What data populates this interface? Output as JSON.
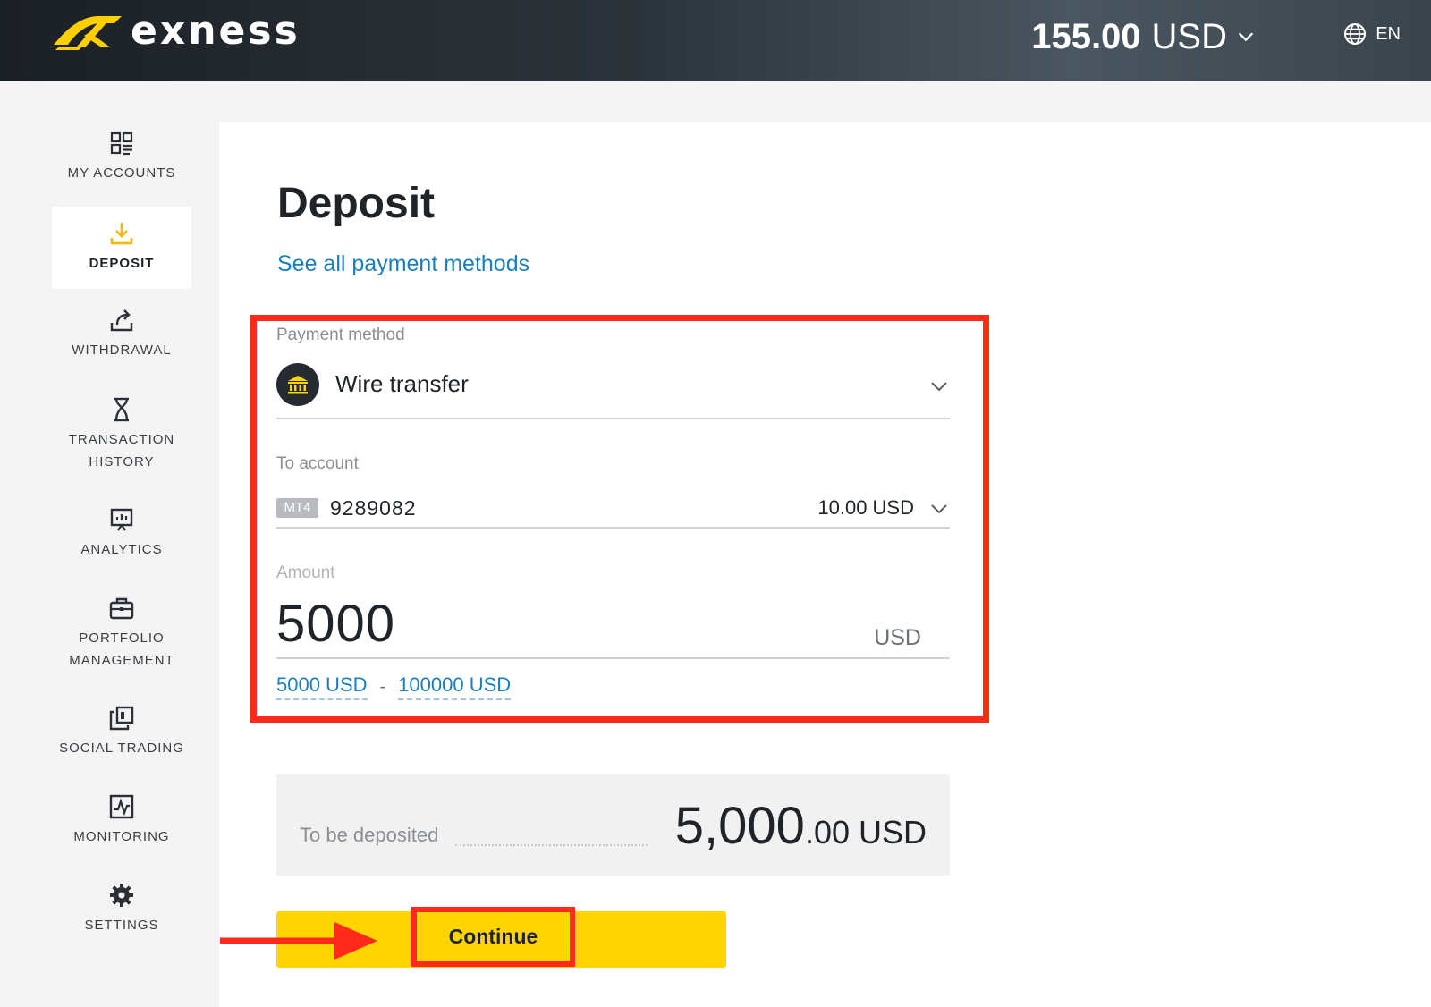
{
  "header": {
    "logo_text": "exness",
    "balance_amount": "155.00",
    "balance_currency": "USD",
    "language": "EN"
  },
  "sidebar": {
    "items": [
      {
        "label": "MY ACCOUNTS",
        "icon": "grid-icon"
      },
      {
        "label": "DEPOSIT",
        "icon": "download-icon",
        "active": true
      },
      {
        "label": "WITHDRAWAL",
        "icon": "upload-share-icon"
      },
      {
        "label": "TRANSACTION HISTORY",
        "icon": "hourglass-icon"
      },
      {
        "label": "ANALYTICS",
        "icon": "presentation-chart-icon"
      },
      {
        "label": "PORTFOLIO MANAGEMENT",
        "icon": "briefcase-icon"
      },
      {
        "label": "SOCIAL TRADING",
        "icon": "copy-icon"
      },
      {
        "label": "MONITORING",
        "icon": "pulse-chart-icon"
      },
      {
        "label": "SETTINGS",
        "icon": "gear-icon"
      }
    ]
  },
  "main": {
    "title": "Deposit",
    "see_all_link": "See all payment methods",
    "payment_method": {
      "label": "Payment method",
      "value": "Wire transfer",
      "icon": "bank-icon"
    },
    "to_account": {
      "label": "To account",
      "platform": "MT4",
      "number": "9289082",
      "balance": "10.00 USD"
    },
    "amount": {
      "label": "Amount",
      "value": "5000",
      "currency": "USD",
      "min": "5000 USD",
      "separator": "-",
      "max": "100000 USD"
    },
    "summary": {
      "label": "To be deposited",
      "value_major": "5,000",
      "value_minor": ".00",
      "currency": "USD"
    },
    "continue_label": "Continue"
  },
  "colors": {
    "accent_yellow": "#ffd400",
    "link_blue": "#1a7fc1",
    "highlight_red": "#ff2a1a",
    "header_dark": "#1b2025"
  }
}
